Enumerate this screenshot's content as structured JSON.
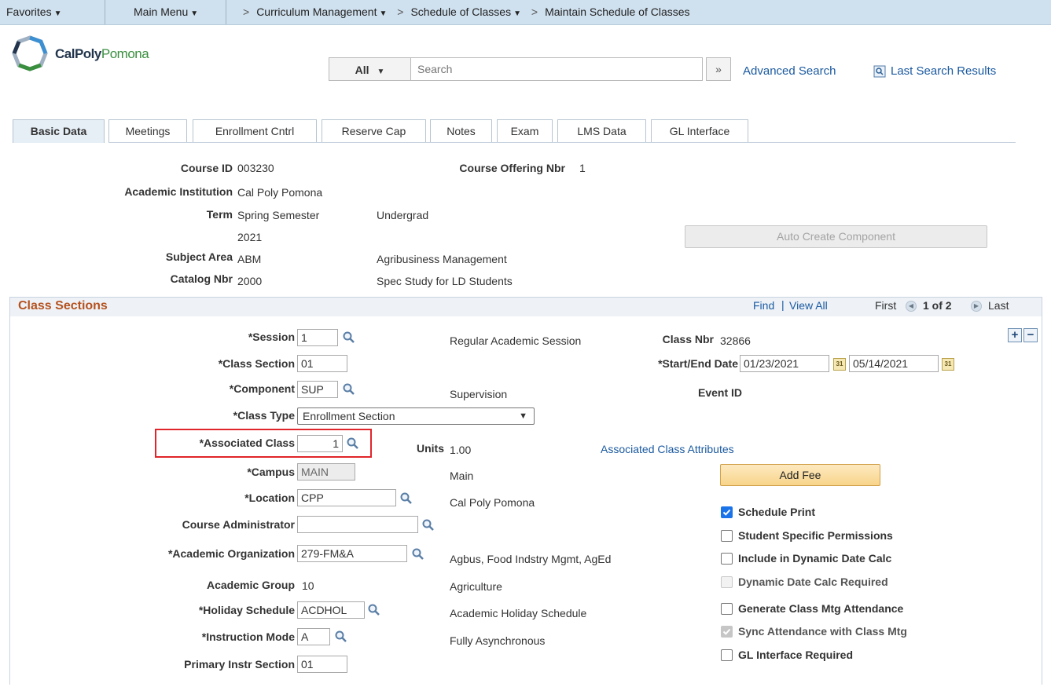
{
  "nav": {
    "favorites": "Favorites",
    "main_menu": "Main Menu",
    "crumb1": "Curriculum Management",
    "crumb2": "Schedule of Classes",
    "crumb3": "Maintain Schedule of Classes"
  },
  "header": {
    "logo_text_a": "CalPoly",
    "logo_text_b": "Pomona",
    "search_category": "All",
    "search_placeholder": "Search",
    "advanced_search": "Advanced Search",
    "last_search_results": "Last Search Results"
  },
  "tabs": [
    {
      "label": "Basic Data"
    },
    {
      "label": "Meetings"
    },
    {
      "label": "Enrollment Cntrl"
    },
    {
      "label": "Reserve Cap"
    },
    {
      "label": "Notes"
    },
    {
      "label": "Exam"
    },
    {
      "label": "LMS Data"
    },
    {
      "label": "GL Interface"
    }
  ],
  "course": {
    "course_id_label": "Course ID",
    "course_id": "003230",
    "offering_label": "Course Offering Nbr",
    "offering": "1",
    "institution_label": "Academic Institution",
    "institution": "Cal Poly Pomona",
    "term_label": "Term",
    "term": "Spring Semester",
    "term_year": "2021",
    "career": "Undergrad",
    "subject_label": "Subject Area",
    "subject": "ABM",
    "subject_desc": "Agribusiness Management",
    "catalog_label": "Catalog Nbr",
    "catalog": "2000",
    "catalog_desc": "Spec Study for LD Students",
    "auto_create": "Auto Create Component"
  },
  "section": {
    "title": "Class Sections",
    "find": "Find",
    "view_all": "View All",
    "first": "First",
    "count": "1 of 2",
    "last": "Last"
  },
  "fields": {
    "session_label": "*Session",
    "session": "1",
    "session_desc": "Regular Academic Session",
    "class_nbr_label": "Class Nbr",
    "class_nbr": "32866",
    "class_section_label": "*Class Section",
    "class_section": "01",
    "dates_label": "*Start/End Date",
    "start_date": "01/23/2021",
    "end_date": "05/14/2021",
    "component_label": "*Component",
    "component": "SUP",
    "component_desc": "Supervision",
    "event_id_label": "Event ID",
    "class_type_label": "*Class Type",
    "class_type": "Enrollment Section",
    "assoc_label": "*Associated Class",
    "assoc": "1",
    "units_label": "Units",
    "units": "1.00",
    "assoc_attr": "Associated Class Attributes",
    "campus_label": "*Campus",
    "campus": "MAIN",
    "campus_desc": "Main",
    "add_fee": "Add Fee",
    "location_label": "*Location",
    "location": "CPP",
    "location_desc": "Cal Poly Pomona",
    "admin_label": "Course Administrator",
    "admin": "",
    "acad_org_label": "*Academic Organization",
    "acad_org": "279-FM&A",
    "acad_org_desc": "Agbus, Food Indstry Mgmt, AgEd",
    "acad_group_label": "Academic Group",
    "acad_group": "10",
    "acad_group_desc": "Agriculture",
    "holiday_label": "*Holiday Schedule",
    "holiday": "ACDHOL",
    "holiday_desc": "Academic Holiday Schedule",
    "instr_mode_label": "*Instruction Mode",
    "instr_mode": "A",
    "instr_mode_desc": "Fully Asynchronous",
    "primary_label": "Primary Instr Section",
    "primary": "01"
  },
  "checks": [
    {
      "label": "Schedule Print",
      "checked": true,
      "disabled": false
    },
    {
      "label": "Student Specific Permissions",
      "checked": false,
      "disabled": false
    },
    {
      "label": "Include in Dynamic Date Calc",
      "checked": false,
      "disabled": false
    },
    {
      "label": "Dynamic Date Calc Required",
      "checked": false,
      "disabled": true
    },
    {
      "label": "Generate Class Mtg Attendance",
      "checked": false,
      "disabled": false
    },
    {
      "label": "Sync Attendance with Class Mtg",
      "checked": true,
      "disabled": true
    },
    {
      "label": "GL Interface Required",
      "checked": false,
      "disabled": false
    }
  ],
  "colors": {
    "nav_bg": "#cfe0ee",
    "link": "#1b5aa0",
    "section_title": "#b5521f",
    "highlight": "#e0252b",
    "check_on": "#1a73e8"
  }
}
